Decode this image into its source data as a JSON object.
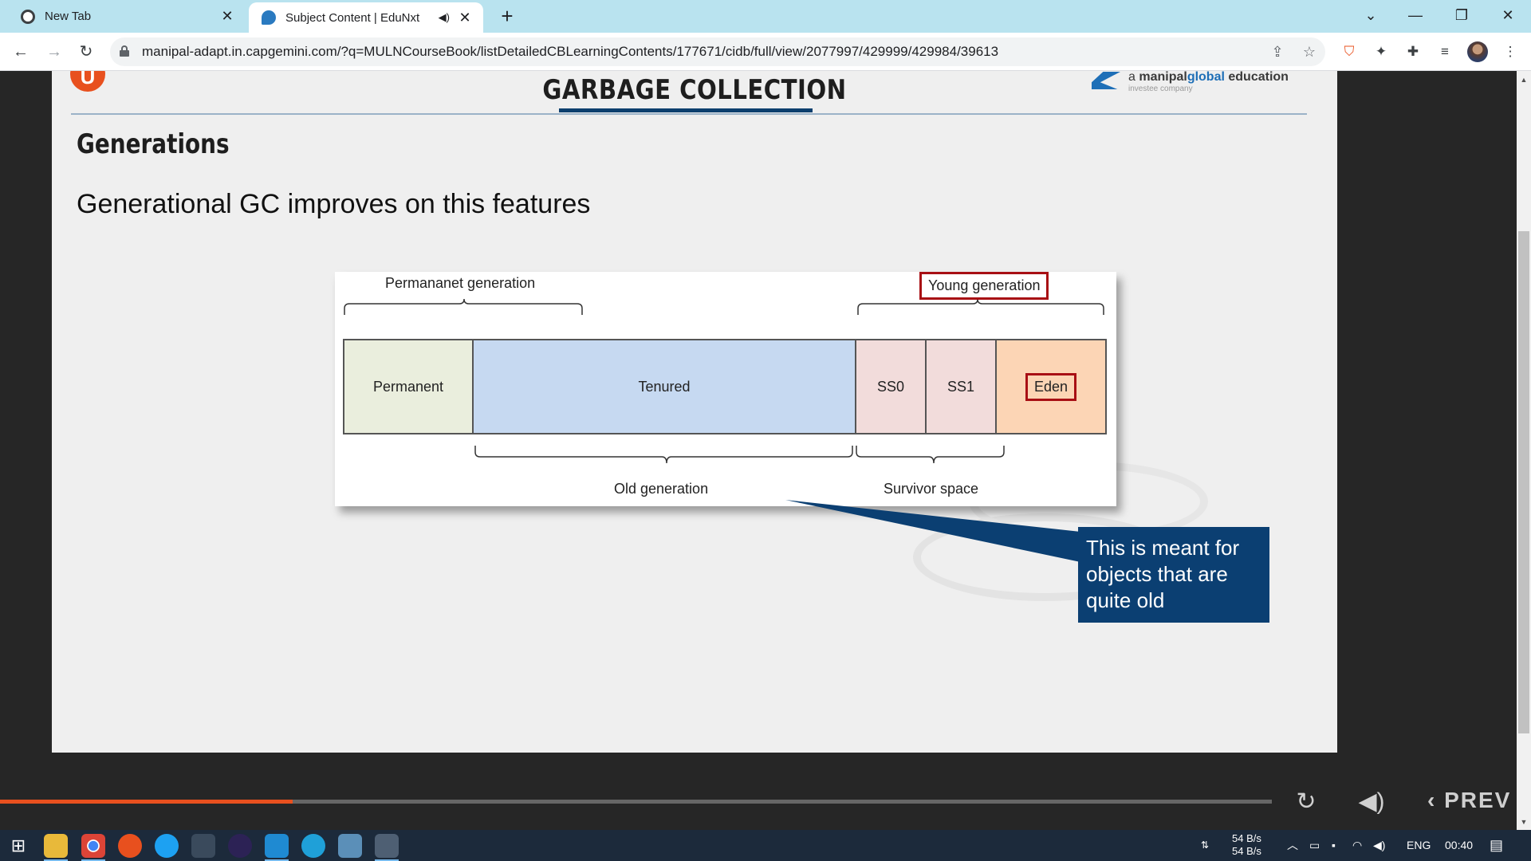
{
  "browser": {
    "tabs": [
      {
        "title": "New Tab",
        "active": false
      },
      {
        "title": "Subject Content | EduNxt",
        "active": true
      }
    ],
    "url": "manipal-adapt.in.capgemini.com/?q=MULNCourseBook/listDetailedCBLearningContents/177671/cidb/full/view/2077997/429999/429984/39613"
  },
  "slide": {
    "title": "GARBAGE COLLECTION",
    "brand_prefix": "a ",
    "brand_name_1": "manipal",
    "brand_name_2": "global",
    "brand_name_3": " education",
    "brand_sub": "investee company",
    "section_title": "Generations",
    "body_text": "Generational GC improves on this features",
    "diagram": {
      "top_left_label": "Permananet generation",
      "top_right_label": "Young generation",
      "segments": [
        "Permanent",
        "Tenured",
        "SS0",
        "SS1",
        "Eden"
      ],
      "bottom_left_label": "Old generation",
      "bottom_right_label": "Survivor space"
    },
    "callout": "This is meant for objects that are quite old"
  },
  "player": {
    "progress": 0.23,
    "prev_label": "PREV"
  },
  "taskbar": {
    "net_up": "54 B/s",
    "net_down": "54 B/s",
    "lang": "ENG",
    "time": "00:40"
  },
  "colors": {
    "accent": "#e8501e",
    "navy": "#0b3f72",
    "permanent_fill": "#eaeedd",
    "tenured_fill": "#c6d9f1",
    "survivor_fill": "#f2dcdb",
    "eden_fill": "#fcd5b5",
    "highlight": "#a80f14"
  }
}
